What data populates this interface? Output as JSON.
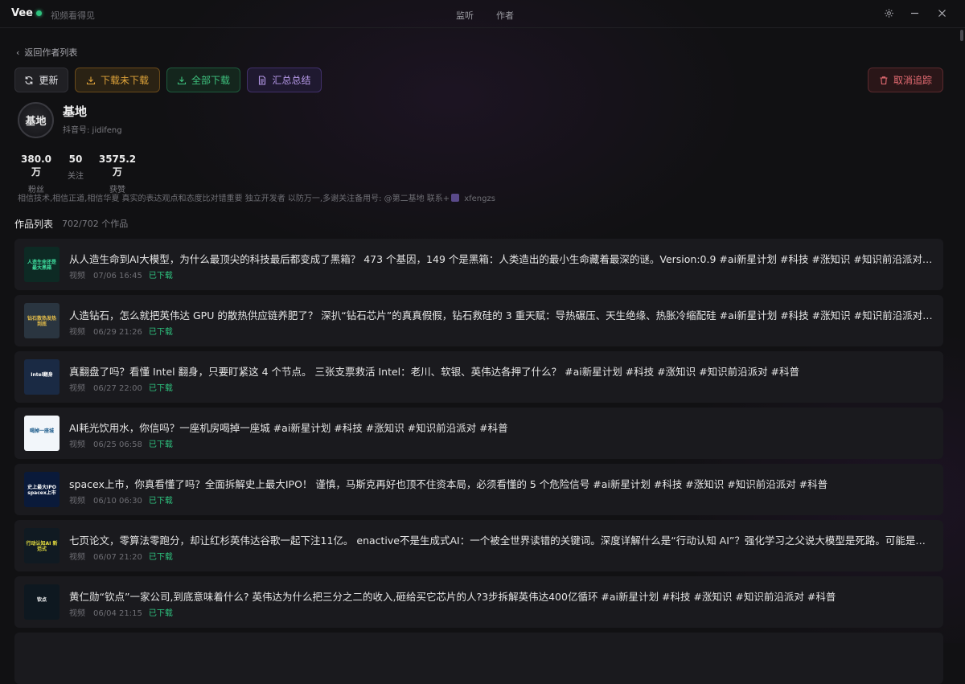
{
  "app": {
    "name": "Vee",
    "slogan": "视频看得见",
    "status_color": "#2ec27e"
  },
  "nav": {
    "tabs": [
      {
        "label": "监听"
      },
      {
        "label": "作者"
      }
    ]
  },
  "window_controls": {
    "settings_icon": "gear-icon",
    "minimize_icon": "minimize-icon",
    "close_icon": "close-icon"
  },
  "back_link": {
    "label": "返回作者列表"
  },
  "toolbar": {
    "refresh_label": "更新",
    "download_undownloaded_label": "下载未下载",
    "download_all_label": "全部下载",
    "summary_label": "汇总总结",
    "cancel_follow_label": "取消追踪"
  },
  "profile": {
    "avatar_text": "基地",
    "name": "基地",
    "douyin_id": "抖音号: jidifeng",
    "stats": [
      {
        "value": "380.0万",
        "label": "粉丝"
      },
      {
        "value": "50",
        "label": "关注"
      },
      {
        "value": "3575.2万",
        "label": "获赞"
      }
    ],
    "bio_text": "相信技术,相信正道,相信华夏 真实的表达观点和态度比对错重要 独立开发者 以防万一,多谢关注备用号: @第二基地 联系+",
    "bio_contact": "xfengzs"
  },
  "works": {
    "title": "作品列表",
    "count": "702/702 个作品",
    "items": [
      {
        "title": "从人造生命到AI大模型，为什么最顶尖的科技最后都变成了黑箱？ 473 个基因，149 个是黑箱：人类造出的最小生命藏着最深的谜。Version:0.9 #ai新星计划 #科技 #涨知识 #知识前沿派对 #科普",
        "type": "视频",
        "date": "07/06 16:45",
        "status": "已下载"
      },
      {
        "title": "人造钻石，怎么就把英伟达 GPU 的散热供应链养肥了？ 深扒“钻石芯片”的真真假假，钻石救硅的 3 重天赋：导热碾压、天生绝缘、热胀冷缩配硅 #ai新星计划 #科技 #涨知识 #知识前沿派对 #科普",
        "type": "视频",
        "date": "06/29 21:26",
        "status": "已下载"
      },
      {
        "title": "真翻盘了吗？看懂 Intel 翻身，只要盯紧这 4 个节点。 三张支票救活 Intel：老川、软银、英伟达各押了什么？ #ai新星计划 #科技 #涨知识 #知识前沿派对 #科普",
        "type": "视频",
        "date": "06/27 22:00",
        "status": "已下载"
      },
      {
        "title": "AI耗光饮用水，你信吗？一座机房喝掉一座城 #ai新星计划 #科技 #涨知识 #知识前沿派对 #科普",
        "type": "视频",
        "date": "06/25 06:58",
        "status": "已下载"
      },
      {
        "title": "spacex上市，你真看懂了吗？全面拆解史上最大IPO！ 谨慎，马斯克再好也顶不住资本局，必须看懂的 5 个危险信号 #ai新星计划 #科技 #涨知识 #知识前沿派对 #科普",
        "type": "视频",
        "date": "06/10 06:30",
        "status": "已下载"
      },
      {
        "title": "七页论文，零算法零跑分，却让红杉英伟达谷歌一起下注11亿。 enactive不是生成式AI：一个被全世界读错的关键词。深度详解什么是“行动认知 AI”？强化学习之父说大模型是死路。可能是下一个AI的新范式 #ai新星计划 #科技",
        "type": "视频",
        "date": "06/07 21:20",
        "status": "已下载"
      },
      {
        "title": "黄仁勋“钦点”一家公司,到底意味着什么? 英伟达为什么把三分之二的收入,砸给买它芯片的人?3步拆解英伟达400亿循环 #ai新星计划 #科技 #涨知识 #知识前沿派对 #科普",
        "type": "视频",
        "date": "06/04 21:15",
        "status": "已下载"
      }
    ],
    "thumbnails": [
      {
        "caption": "人造生命还是最大黑箱",
        "bg": "#0d2a24",
        "fg": "#3fe0a0"
      },
      {
        "caption": "钻石散热发热到底",
        "bg": "#2a3540",
        "fg": "#e8c04a"
      },
      {
        "caption": "Intel翻身",
        "bg": "#1a2a44",
        "fg": "#ffffff"
      },
      {
        "caption": "喝掉一座城",
        "bg": "#f2f6fa",
        "fg": "#1a5a8a"
      },
      {
        "caption": "史上最大IPO spacex上市",
        "bg": "#0a1a3a",
        "fg": "#ffffff"
      },
      {
        "caption": "行动认知AI 新范式",
        "bg": "#101a22",
        "fg": "#e8e040"
      },
      {
        "caption": "钦点",
        "bg": "#0e1820",
        "fg": "#ffffff"
      }
    ]
  }
}
